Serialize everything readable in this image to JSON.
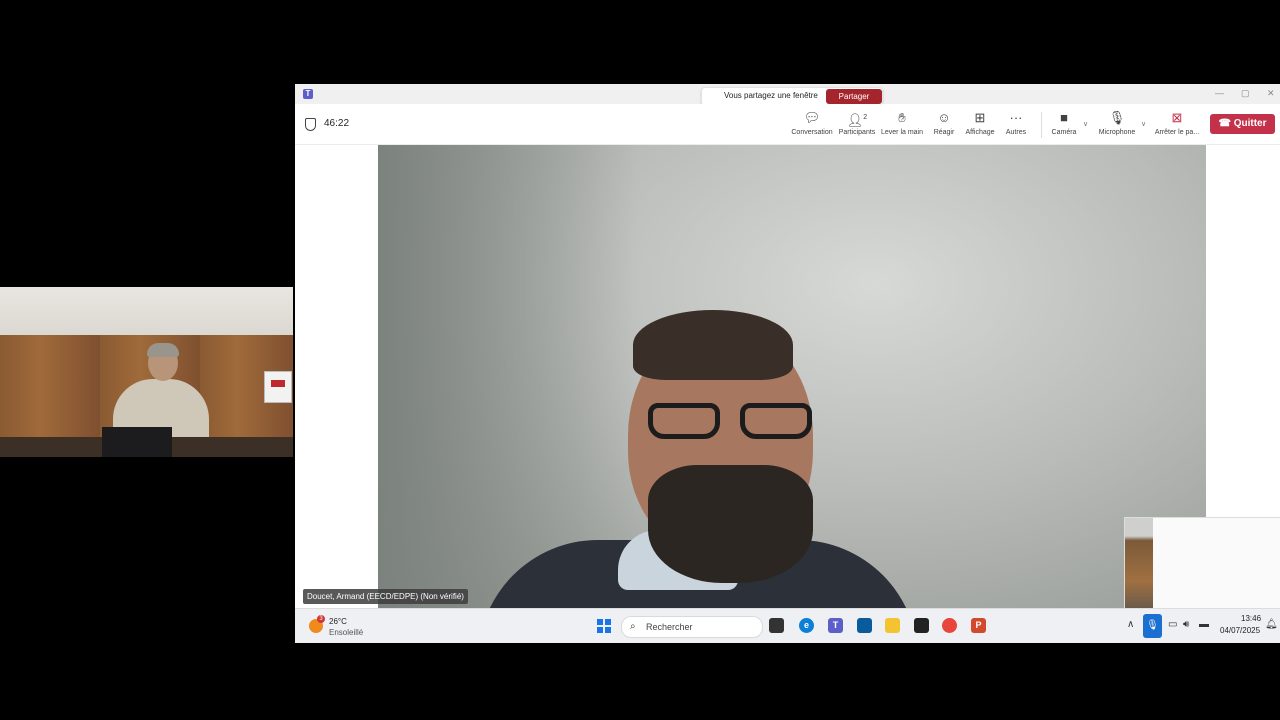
{
  "meeting": {
    "timer": "46:22",
    "share_banner": {
      "text": "Vous partagez une fenêtre",
      "button": "Partager"
    },
    "toolbar": {
      "conversation": "Conversation",
      "participants": "Participants",
      "participants_count": "2",
      "raise_hand": "Lever la main",
      "react": "Réagir",
      "view": "Affichage",
      "more": "Autres",
      "camera": "Caméra",
      "microphone": "Microphone",
      "stop_share": "Arrêter le pa...",
      "leave": "Quitter"
    },
    "speaker_name": "Doucet, Armand (EECD/EDPE) (Non vérifié)"
  },
  "taskbar": {
    "weather_temp": "26°C",
    "weather_desc": "Ensoleillé",
    "weather_badge": "3",
    "search_placeholder": "Rechercher",
    "time": "13:46",
    "date": "04/07/2025"
  },
  "icons": {
    "conversation": "chat-bubble-icon",
    "participants": "people-icon",
    "raise_hand": "hand-icon",
    "react": "smiley-icon",
    "view": "grid-icon",
    "more": "ellipsis-icon",
    "camera": "video-camera-icon",
    "microphone": "microphone-icon",
    "stop_share": "stop-share-icon",
    "leave": "phone-hangup-icon"
  },
  "colors": {
    "leave_button": "#c4314b",
    "share_button": "#a4262c",
    "teams_brand": "#5b5fc7",
    "mic_tray": "#1a6fd1"
  }
}
